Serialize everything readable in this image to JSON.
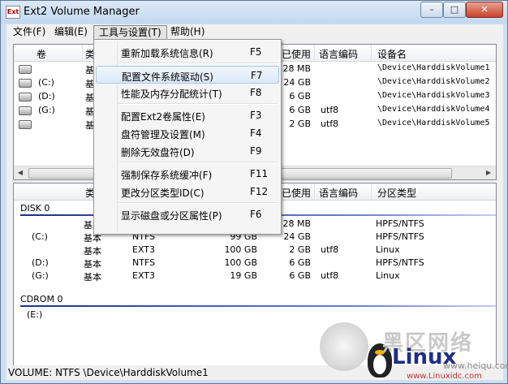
{
  "window": {
    "title": "Ext2 Volume Manager",
    "icon_text": "Ext"
  },
  "menubar": [
    {
      "label": "文件(F)"
    },
    {
      "label": "编辑(E)"
    },
    {
      "label": "工具与设置(T)"
    },
    {
      "label": "帮助(H)"
    }
  ],
  "tools_menu": {
    "groups": [
      [
        {
          "label": "重新加载系统信息(R)",
          "key": "F5"
        }
      ],
      [
        {
          "label": "配置文件系统驱动(S)",
          "key": "F7"
        },
        {
          "label": "性能及内存分配统计(T)",
          "key": "F8"
        }
      ],
      [
        {
          "label": "配置Ext2卷属性(E)",
          "key": "F3"
        },
        {
          "label": "盘符管理及设置(M)",
          "key": "F4"
        },
        {
          "label": "删除无效盘符(D)",
          "key": "F9"
        }
      ],
      [
        {
          "label": "强制保存系统缓冲(F)",
          "key": "F11"
        },
        {
          "label": "更改分区类型ID(C)",
          "key": "F12"
        }
      ],
      [
        {
          "label": "显示磁盘或分区属性(P)",
          "key": "F6"
        }
      ]
    ],
    "highlighted": "配置文件系统驱动(S)"
  },
  "volumes": {
    "columns": [
      "卷",
      "类",
      "已使用",
      "语言编码",
      "设备名"
    ],
    "rows": [
      {
        "vol": "",
        "type": "基",
        "used": "28 MB",
        "enc": "",
        "dev": "\\Device\\HarddiskVolume1"
      },
      {
        "vol": "(C:)",
        "type": "基",
        "used": "24 GB",
        "enc": "",
        "dev": "\\Device\\HarddiskVolume2"
      },
      {
        "vol": "(D:)",
        "type": "基",
        "used": "6 GB",
        "enc": "",
        "dev": "\\Device\\HarddiskVolume3"
      },
      {
        "vol": "(G:)",
        "type": "基",
        "used": "6 GB",
        "enc": "utf8",
        "dev": "\\Device\\HarddiskVolume4"
      },
      {
        "vol": "",
        "type": "基",
        "used": "2 GB",
        "enc": "utf8",
        "dev": "\\Device\\HarddiskVolume5"
      }
    ]
  },
  "disks": {
    "columns": [
      "类",
      "已使用",
      "语言编码",
      "分区类型"
    ],
    "disk0": {
      "label": "DISK 0",
      "rows": [
        {
          "vol": "",
          "type": "基本",
          "fs": "",
          "size": "",
          "used": "28 MB",
          "enc": "",
          "ptype": "HPFS/NTFS"
        },
        {
          "vol": "(C:)",
          "type": "基本",
          "fs": "NTFS",
          "size": "99 GB",
          "used": "24 GB",
          "enc": "",
          "ptype": "HPFS/NTFS"
        },
        {
          "vol": "",
          "type": "基本",
          "fs": "EXT3",
          "size": "100 GB",
          "used": "2 GB",
          "enc": "utf8",
          "ptype": "Linux"
        },
        {
          "vol": "(D:)",
          "type": "基本",
          "fs": "NTFS",
          "size": "100 GB",
          "used": "6 GB",
          "enc": "",
          "ptype": "HPFS/NTFS"
        },
        {
          "vol": "(G:)",
          "type": "基本",
          "fs": "EXT3",
          "size": "19 GB",
          "used": "6 GB",
          "enc": "utf8",
          "ptype": "Linux"
        }
      ]
    },
    "cdrom0": {
      "label": "CDROM 0",
      "rows": [
        {
          "vol": "(E:)"
        }
      ]
    }
  },
  "status": {
    "text": "VOLUME:  NTFS \\Device\\HarddiskVolume1"
  },
  "watermark": {
    "brand": "Linux",
    "cn": "黑区网络",
    "site": "www.heiqu.com",
    "site2": "www.Linuxidc.com"
  },
  "colors": {
    "menu_highlight": "#dbe9f9",
    "disk_line": "#1b2f8c"
  }
}
